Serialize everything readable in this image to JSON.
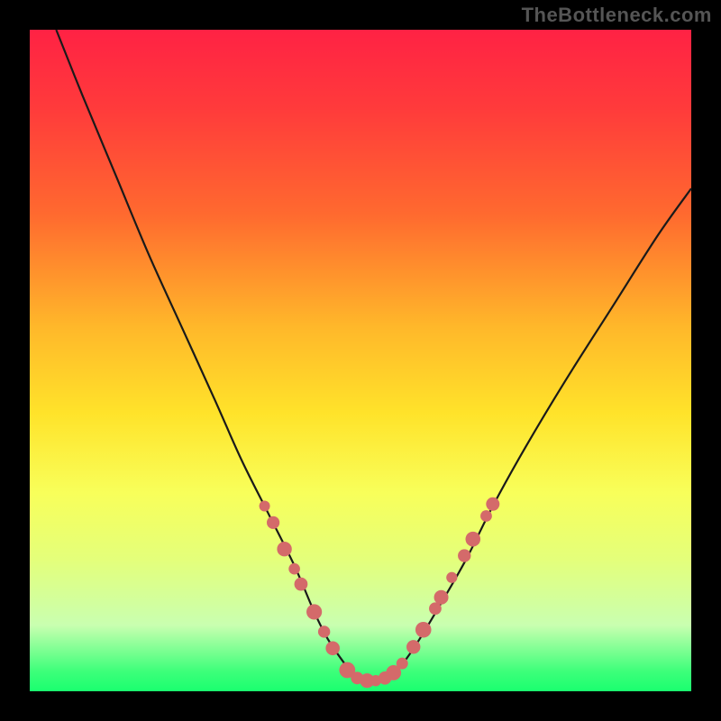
{
  "watermark": "TheBottleneck.com",
  "chart_data": {
    "type": "line",
    "title": "",
    "xlabel": "",
    "ylabel": "",
    "xlim": [
      0,
      100
    ],
    "ylim": [
      0,
      100
    ],
    "background_gradient": {
      "top": "#ff2244",
      "bottom": "#1aff6f"
    },
    "series": [
      {
        "name": "bottleneck-curve",
        "x": [
          4,
          8,
          13,
          18,
          23,
          28,
          32,
          36,
          40,
          43,
          45,
          47,
          49,
          51,
          53,
          55,
          57,
          59,
          62,
          66,
          70,
          75,
          81,
          88,
          95,
          100
        ],
        "y": [
          100,
          90,
          78,
          66,
          55,
          44,
          35,
          27,
          19,
          12,
          8,
          5,
          2.5,
          1.5,
          1.5,
          2.5,
          5,
          8,
          13,
          20,
          28,
          37,
          47,
          58,
          69,
          76
        ]
      }
    ],
    "markers": {
      "name": "bottleneck-markers",
      "color": "#d46a6a",
      "radius_range": [
        6,
        9
      ],
      "points": [
        {
          "x": 35.5,
          "y": 28
        },
        {
          "x": 36.8,
          "y": 25.5
        },
        {
          "x": 38.5,
          "y": 21.5
        },
        {
          "x": 40.0,
          "y": 18.5
        },
        {
          "x": 41.0,
          "y": 16.2
        },
        {
          "x": 43.0,
          "y": 12.0
        },
        {
          "x": 44.5,
          "y": 9.0
        },
        {
          "x": 45.8,
          "y": 6.5
        },
        {
          "x": 48.0,
          "y": 3.2
        },
        {
          "x": 49.5,
          "y": 2.0
        },
        {
          "x": 51.0,
          "y": 1.6
        },
        {
          "x": 52.3,
          "y": 1.6
        },
        {
          "x": 53.7,
          "y": 2.0
        },
        {
          "x": 55.0,
          "y": 2.8
        },
        {
          "x": 56.3,
          "y": 4.2
        },
        {
          "x": 58.0,
          "y": 6.7
        },
        {
          "x": 59.5,
          "y": 9.3
        },
        {
          "x": 61.3,
          "y": 12.5
        },
        {
          "x": 62.2,
          "y": 14.2
        },
        {
          "x": 63.8,
          "y": 17.2
        },
        {
          "x": 65.7,
          "y": 20.5
        },
        {
          "x": 67.0,
          "y": 23.0
        },
        {
          "x": 69.0,
          "y": 26.5
        },
        {
          "x": 70.0,
          "y": 28.3
        }
      ]
    }
  }
}
